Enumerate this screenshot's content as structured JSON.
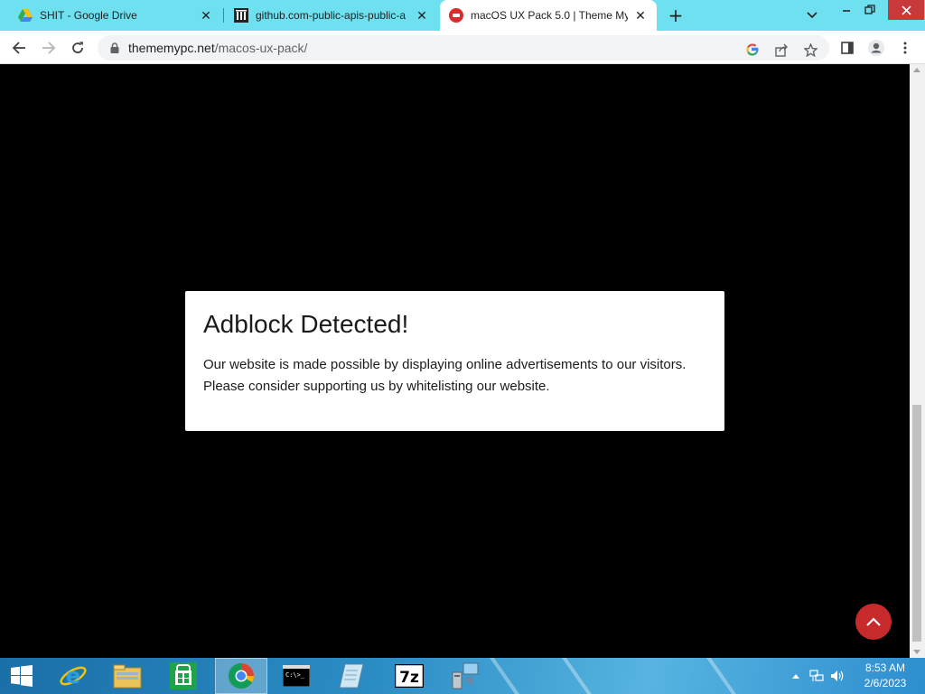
{
  "browser": {
    "tabs": [
      {
        "title": "SHIT - Google Drive",
        "favicon": "google-drive-icon",
        "active": false
      },
      {
        "title": "github.com-public-apis-public-a",
        "favicon": "github-archive-icon",
        "active": false
      },
      {
        "title": "macOS UX Pack 5.0 | Theme My",
        "favicon": "thememypc-icon",
        "active": true
      }
    ],
    "address": {
      "domain": "thememypc.net",
      "path": "/macos-ux-pack/"
    }
  },
  "page": {
    "modal": {
      "title": "Adblock Detected!",
      "message_line1": "Our website is made possible by displaying online advertisements to our visitors.",
      "message_line2": "Please consider supporting us by whitelisting our website."
    },
    "accent_color": "#c62a2a"
  },
  "taskbar": {
    "items": [
      "start-button",
      "internet-explorer",
      "file-explorer",
      "windows-store",
      "google-chrome",
      "command-prompt",
      "notepad-app",
      "7zip",
      "remote-desktop"
    ],
    "clock": {
      "time": "8:53 AM",
      "date": "2/6/2023"
    }
  }
}
